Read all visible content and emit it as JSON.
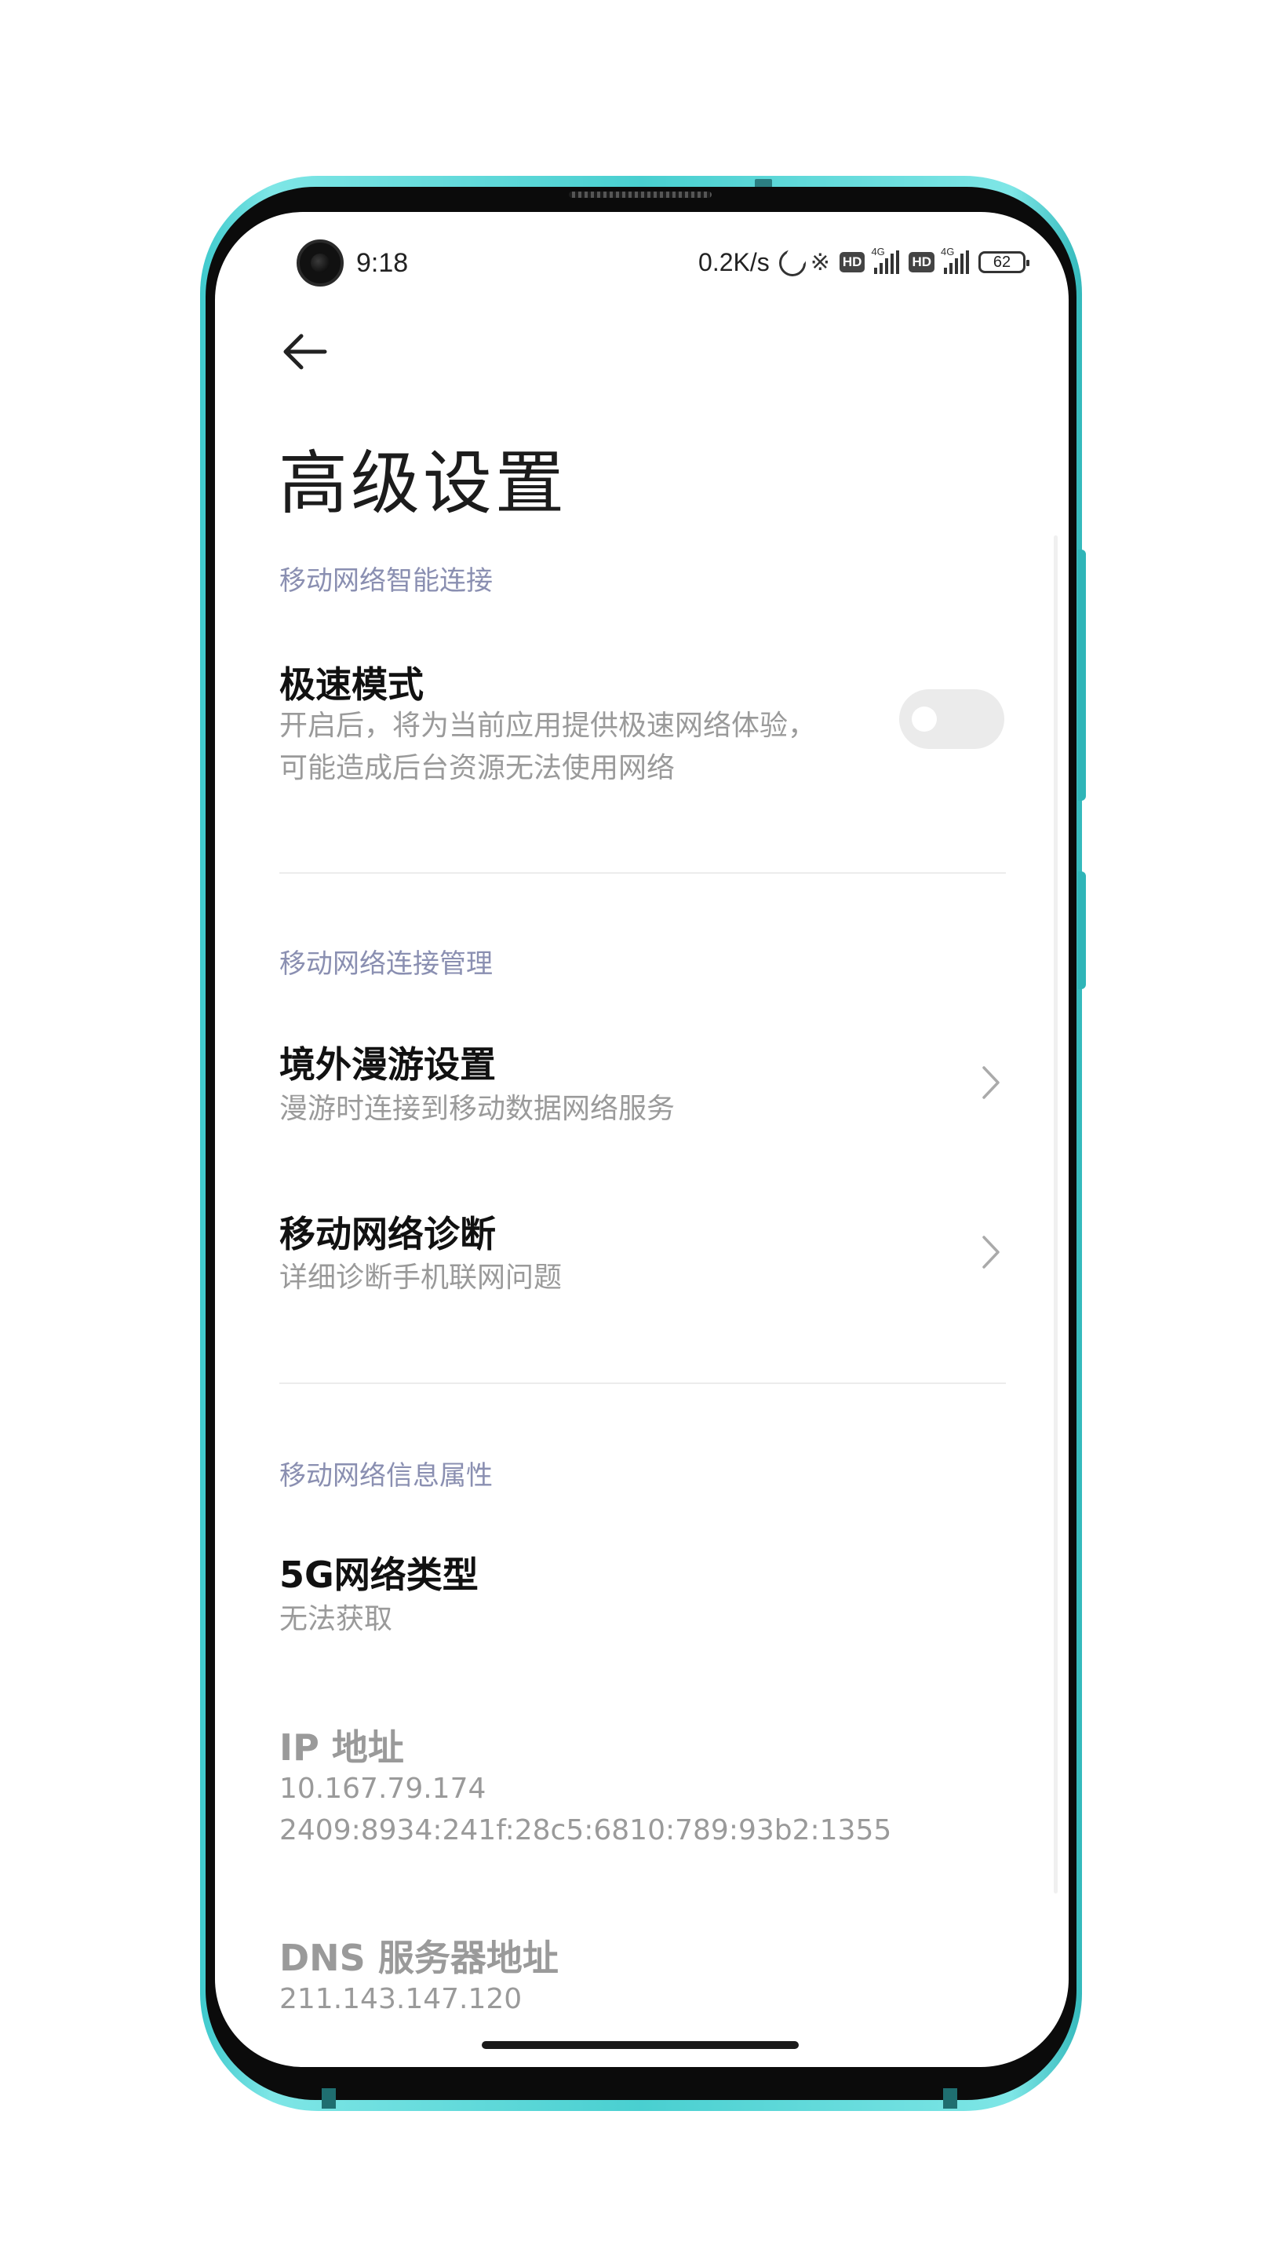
{
  "status_bar": {
    "time": "9:18",
    "net_speed": "0.2K/s",
    "network_tag_1": "4G",
    "network_tag_2": "4G",
    "hd_label_1": "HD",
    "hd_label_2": "HD",
    "battery": "62",
    "icons": [
      "moon-icon",
      "bluetooth-icon",
      "signal-icon",
      "battery-icon"
    ]
  },
  "header": {
    "back_icon": "arrow-left-icon",
    "title": "高级设置"
  },
  "sections": [
    {
      "header": "移动网络智能连接",
      "items": [
        {
          "title": "极速模式",
          "subtitle_line1": "开启后，将为当前应用提供极速网络体验，",
          "subtitle_line2": "可能造成后台资源无法使用网络",
          "control": "toggle",
          "enabled": false
        }
      ]
    },
    {
      "header": "移动网络连接管理",
      "items": [
        {
          "title": "境外漫游设置",
          "subtitle": "漫游时连接到移动数据网络服务",
          "control": "chevron"
        },
        {
          "title": "移动网络诊断",
          "subtitle": "详细诊断手机联网问题",
          "control": "chevron"
        }
      ]
    },
    {
      "header": "移动网络信息属性",
      "items": [
        {
          "title": "5G网络类型",
          "subtitle": "无法获取"
        },
        {
          "title": "IP 地址",
          "value_line1": "10.167.79.174",
          "value_line2": "2409:8934:241f:28c5:6810:789:93b2:1355"
        },
        {
          "title": "DNS 服务器地址",
          "value_line1": "211.143.147.120"
        }
      ]
    }
  ],
  "colors": {
    "frame_accent": "#49cfd0",
    "section_header": "#8a8fb1",
    "subtitle": "#9a9a9a",
    "title": "#111111"
  }
}
